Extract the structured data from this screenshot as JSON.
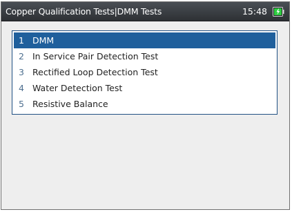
{
  "titlebar": {
    "title": "Copper Qualification Tests|DMM Tests",
    "time": "15:48",
    "battery_icon": "battery-charging-icon",
    "battery_color": "#2ecc40"
  },
  "menu": {
    "selected_color": "#1f5f9c",
    "items": [
      {
        "number": "1",
        "label": "DMM",
        "selected": true
      },
      {
        "number": "2",
        "label": "In Service Pair Detection Test",
        "selected": false
      },
      {
        "number": "3",
        "label": "Rectified Loop Detection Test",
        "selected": false
      },
      {
        "number": "4",
        "label": "Water Detection Test",
        "selected": false
      },
      {
        "number": "5",
        "label": "Resistive Balance",
        "selected": false
      }
    ]
  }
}
